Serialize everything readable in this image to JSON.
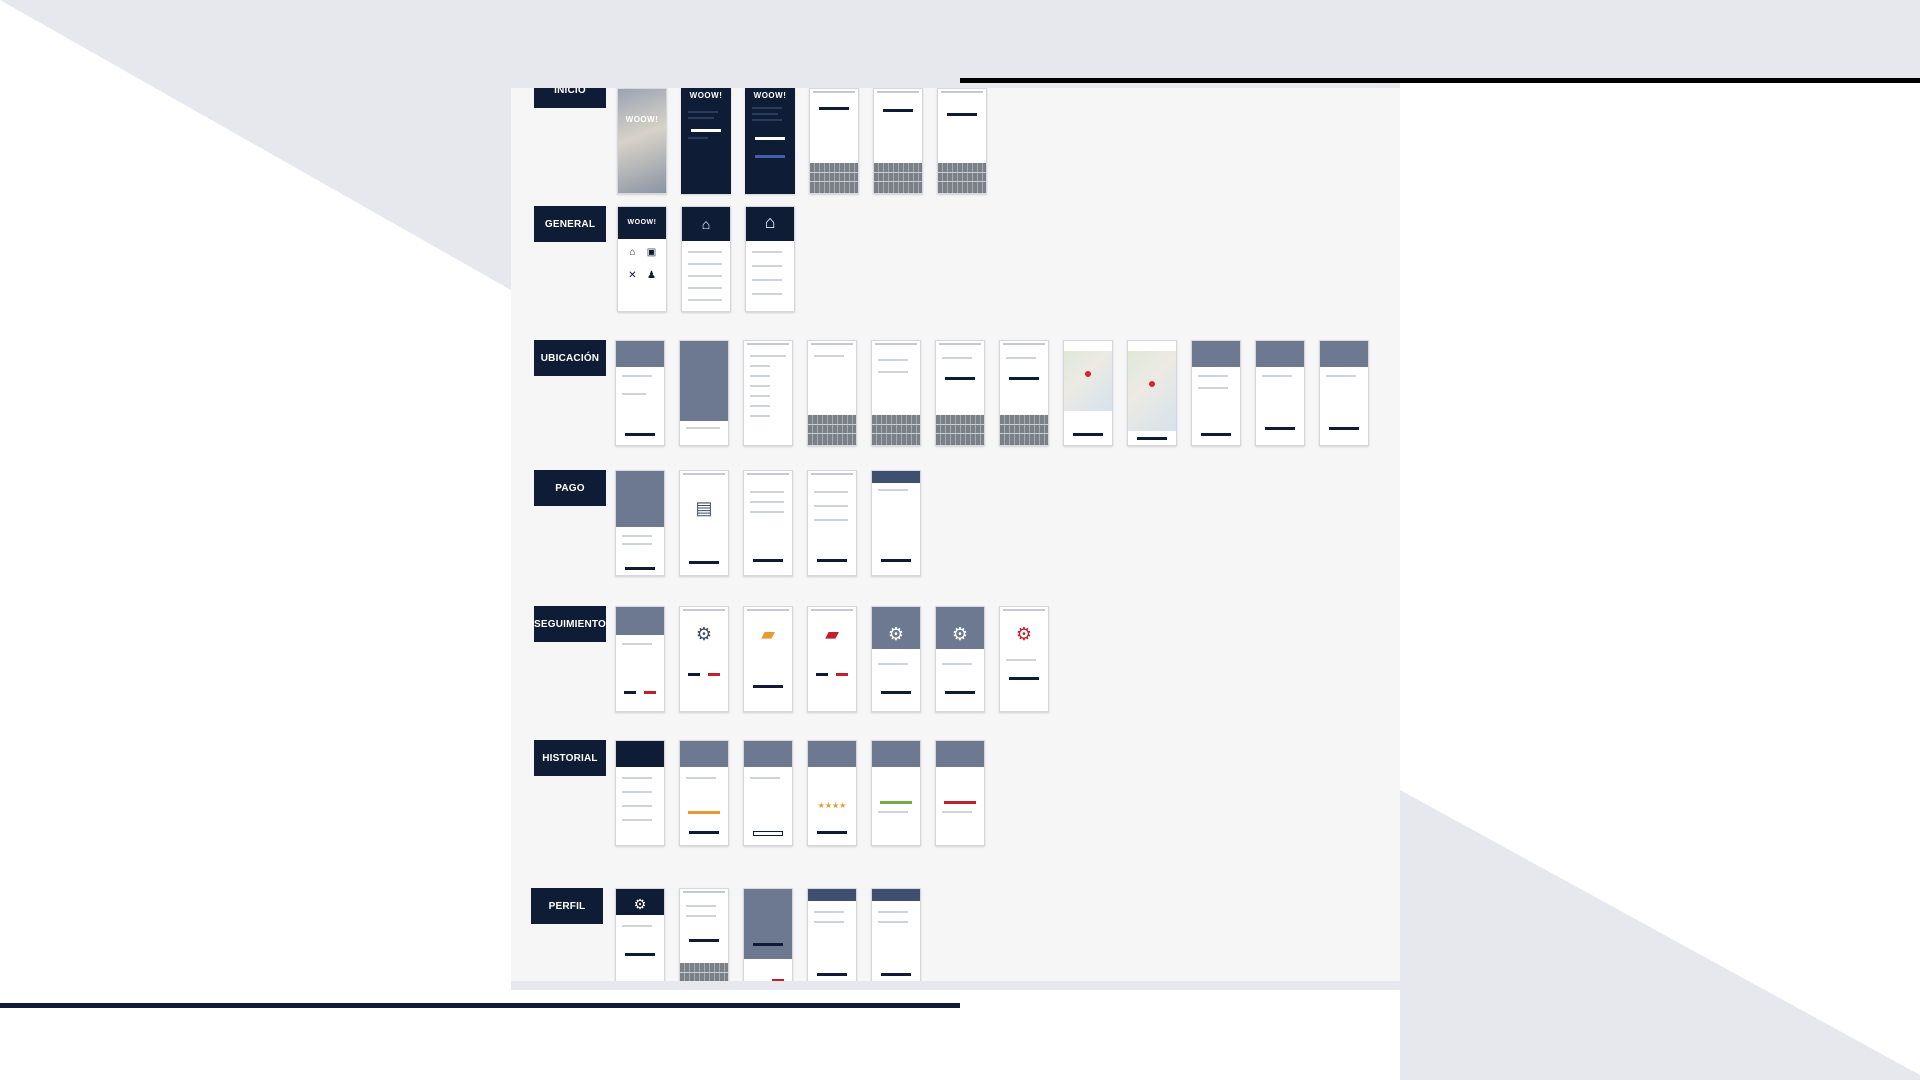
{
  "colors": {
    "navy": "#0f1c35",
    "backdrop_light": "#e7e7ee",
    "board": "#f6f6f7",
    "accent_red": "#c0202e",
    "accent_orange": "#e89b2d",
    "accent_green": "#7aa842"
  },
  "brand": {
    "logo_text": "WOOW!"
  },
  "sections": [
    {
      "label": "INICIO",
      "screens": 6
    },
    {
      "label": "GENERAL",
      "screens": 3
    },
    {
      "label": "UBICACIÓN",
      "screens": 12
    },
    {
      "label": "PAGO",
      "screens": 5
    },
    {
      "label": "SEGUIMIENTO",
      "screens": 7
    },
    {
      "label": "HISTORIAL",
      "screens": 6
    },
    {
      "label": "PERFIL",
      "screens": 5
    }
  ],
  "icons": {
    "home": "home-icon",
    "car": "car-icon",
    "tools": "tools-icon",
    "users": "users-icon",
    "gear": "gear-icon",
    "card": "credit-card-icon",
    "map_pin": "map-pin-icon",
    "stars": "star-rating-icon"
  }
}
